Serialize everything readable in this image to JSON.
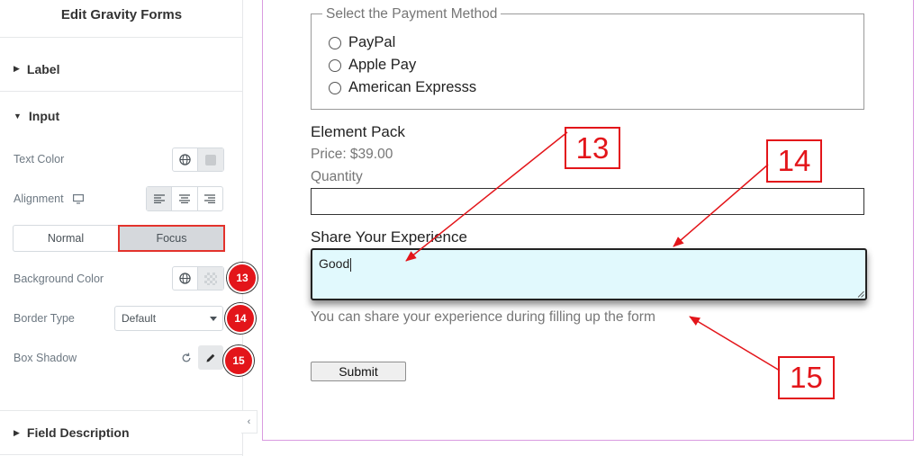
{
  "panel": {
    "title": "Edit Gravity Forms",
    "sections": {
      "label": "Label",
      "input": "Input",
      "field_description": "Field Description"
    },
    "controls": {
      "text_color": "Text Color",
      "alignment": "Alignment",
      "background_color": "Background Color",
      "border_type": "Border Type",
      "box_shadow": "Box Shadow"
    },
    "tabs": {
      "normal": "Normal",
      "focus": "Focus",
      "active": "focus"
    },
    "border_type_value": "Default",
    "alignment_value": "left"
  },
  "badges": [
    "13",
    "14",
    "15"
  ],
  "form": {
    "payment_legend": "Select the Payment Method",
    "payment_options": [
      "PayPal",
      "Apple Pay",
      "American Expresss"
    ],
    "product_name": "Element Pack",
    "price": "Price: $39.00",
    "quantity_label": "Quantity",
    "quantity_value": "",
    "experience_label": "Share Your Experience",
    "experience_value": "Good",
    "experience_description": "You can share your experience during filling up the form",
    "submit_label": "Submit"
  },
  "callouts": [
    "13",
    "14",
    "15"
  ],
  "colors": {
    "accent_red": "#e3151a",
    "focus_bg": "#e1f9fd",
    "preview_border": "#d99be0"
  },
  "icons": [
    "caret-right-icon",
    "caret-down-icon",
    "globe-icon",
    "desktop-icon",
    "align-left-icon",
    "align-center-icon",
    "align-right-icon",
    "reset-icon",
    "pencil-icon",
    "chevron-left-icon"
  ]
}
